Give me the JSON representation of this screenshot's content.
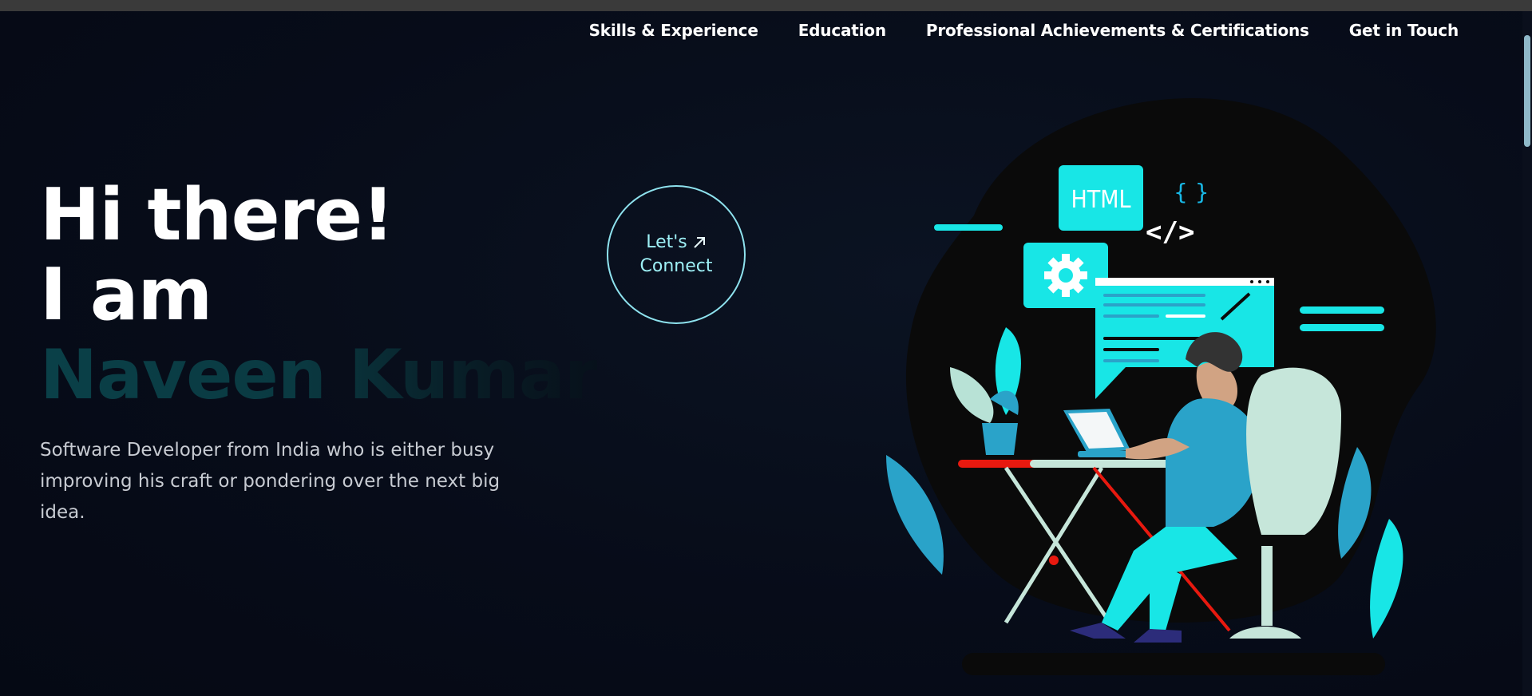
{
  "nav": {
    "items": [
      {
        "label": "Skills & Experience"
      },
      {
        "label": "Education"
      },
      {
        "label": "Professional Achievements & Certifications"
      },
      {
        "label": "Get in Touch"
      }
    ]
  },
  "hero": {
    "greeting": "Hi there!",
    "intro": "I am",
    "name": "Naveen Kumar",
    "description": "Software Developer from India who is either busy improving his craft or pondering over the next big idea."
  },
  "connect": {
    "line1": "Let's",
    "line2": "Connect",
    "icon": "arrow-up-right-icon"
  },
  "illustration": {
    "html_tag": "HTML",
    "code_tag": "</>",
    "braces": "{  }",
    "icons": [
      "gear-icon",
      "code-icon",
      "browser-window-icon",
      "laptop-icon"
    ]
  },
  "colors": {
    "background": "#060b18",
    "accent": "#18e6e6",
    "nav_text": "#ffffff",
    "name_text": "#0a4048",
    "description_text": "#c7cbd2",
    "connect_border": "#8ee2ee"
  }
}
